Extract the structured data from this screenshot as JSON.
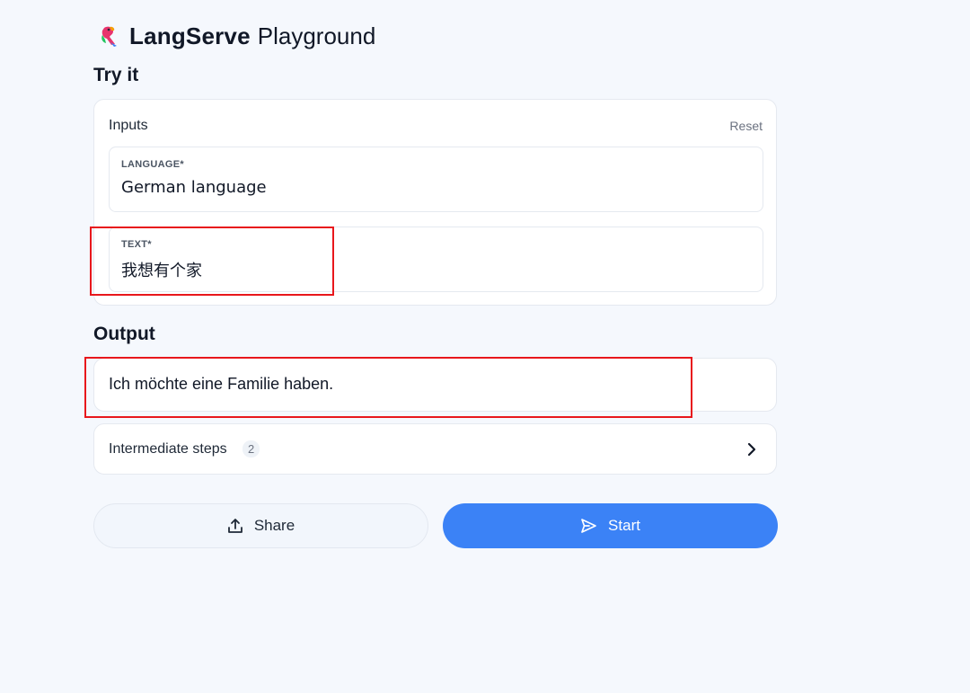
{
  "header": {
    "brand": "LangServe",
    "subtitle": "Playground",
    "logo_icon": "parrot-icon"
  },
  "try_it": {
    "title": "Try it",
    "inputs_label": "Inputs",
    "reset_label": "Reset",
    "fields": [
      {
        "label": "LANGUAGE*",
        "value": "German language"
      },
      {
        "label": "TEXT*",
        "value": "我想有个家"
      }
    ]
  },
  "output": {
    "title": "Output",
    "text": "Ich möchte eine Familie haben."
  },
  "intermediate_steps": {
    "label": "Intermediate steps",
    "count": "2",
    "icon": "chevron-right-icon"
  },
  "actions": {
    "share_label": "Share",
    "share_icon": "share-upload-icon",
    "start_label": "Start",
    "start_icon": "send-icon"
  },
  "colors": {
    "accent": "#3b82f6",
    "background": "#f5f8fd",
    "annotation": "#e8171c"
  }
}
